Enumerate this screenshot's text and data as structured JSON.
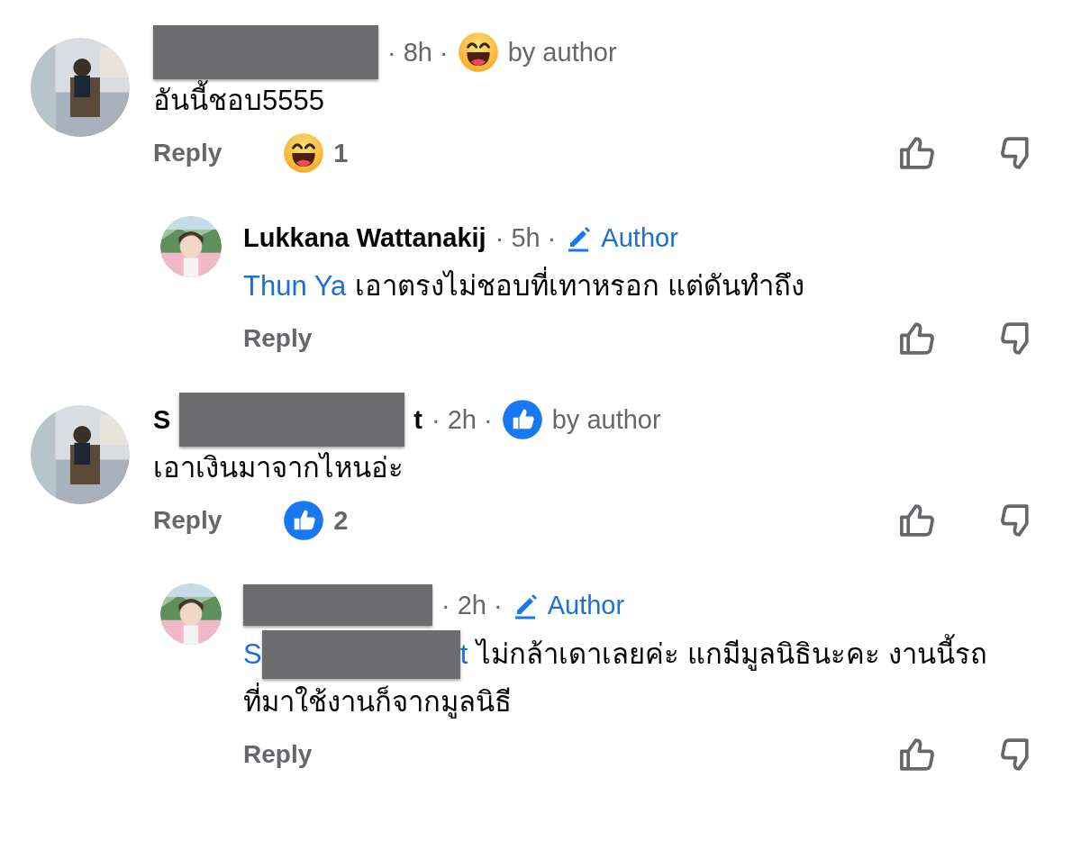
{
  "comments": [
    {
      "kind": "top",
      "author": {
        "redacted": true
      },
      "time": "· 8h ·",
      "badge": {
        "kind": "laugh",
        "label": "by author"
      },
      "lines": [
        "อันนี้ชอบ5555"
      ],
      "reply_label": "Reply",
      "reaction": {
        "kind": "laugh",
        "count": "1"
      }
    },
    {
      "kind": "reply",
      "author": {
        "parts": [
          "Lukkana Wattanakij"
        ]
      },
      "time": "· 5h ·",
      "badge": {
        "kind": "author",
        "label": "Author"
      },
      "mention": {
        "parts": [
          "Thun Ya"
        ]
      },
      "lines": [
        "เอาตรงไม่ชอบที่เทาหรอก แต่ดันทำถึง"
      ],
      "reply_label": "Reply"
    },
    {
      "kind": "top",
      "author": {
        "parts": [
          "S",
          "t"
        ],
        "redacted": true
      },
      "time": "· 2h ·",
      "badge": {
        "kind": "like",
        "label": "by author"
      },
      "lines": [
        "เอาเงินมาจากไหนอ่ะ"
      ],
      "reply_label": "Reply",
      "reaction": {
        "kind": "like",
        "count": "2"
      }
    },
    {
      "kind": "reply",
      "author": {
        "redacted": true
      },
      "time": "· 2h ·",
      "badge": {
        "kind": "author",
        "label": "Author"
      },
      "mention": {
        "parts": [
          "S",
          "t"
        ],
        "redacted": true
      },
      "lines": [
        "ไม่กล้าเดาเลยค่ะ แกมีมูลนิธินะคะ งานนี้รถ",
        "ที่มาใช้งานก็จากมูลนิธี"
      ],
      "reply_label": "Reply"
    }
  ]
}
